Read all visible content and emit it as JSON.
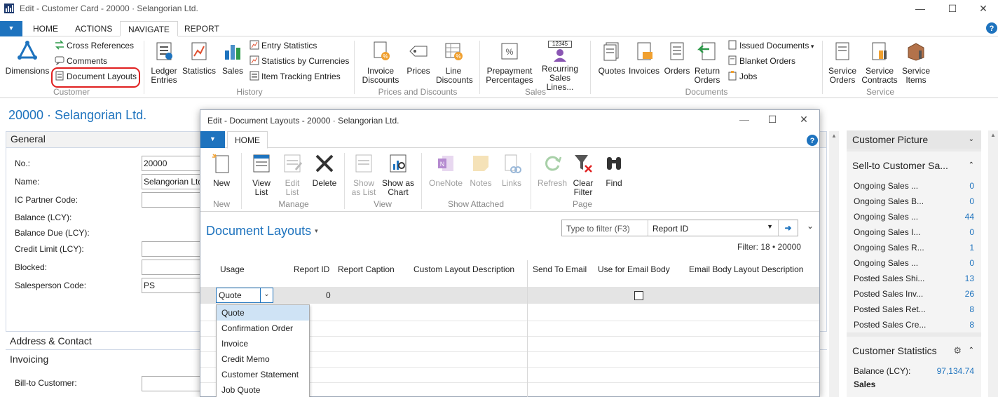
{
  "window": {
    "title": "Edit - Customer Card - 20000 · Selangorian Ltd."
  },
  "ribbon_tabs": [
    "HOME",
    "ACTIONS",
    "NAVIGATE",
    "REPORT"
  ],
  "ribbon": {
    "customer": {
      "dimensions": "Dimensions",
      "cross_references": "Cross References",
      "comments": "Comments",
      "document_layouts": "Document Layouts",
      "label": "Customer"
    },
    "history": {
      "ledger_entries": "Ledger Entries",
      "statistics": "Statistics",
      "sales": "Sales",
      "entry_statistics": "Entry Statistics",
      "statistics_by_currencies": "Statistics by Currencies",
      "item_tracking_entries": "Item Tracking Entries",
      "label": "History"
    },
    "prices": {
      "invoice_discounts": "Invoice Discounts",
      "prices": "Prices",
      "line_discounts": "Line Discounts",
      "label": "Prices and Discounts"
    },
    "sales": {
      "prepayment_percentages": "Prepayment Percentages",
      "recurring_sales_lines": "Recurring Sales Lines...",
      "recurring_badge": "12345",
      "label": "Sales"
    },
    "documents": {
      "quotes": "Quotes",
      "invoices": "Invoices",
      "orders": "Orders",
      "return_orders": "Return Orders",
      "issued_documents": "Issued Documents",
      "blanket_orders": "Blanket Orders",
      "jobs": "Jobs",
      "label": "Documents"
    },
    "service": {
      "service_orders": "Service Orders",
      "service_contracts": "Service Contracts",
      "service_items": "Service Items",
      "label": "Service"
    }
  },
  "page": {
    "title": "20000 · Selangorian Ltd.",
    "general_tab": "General",
    "fields": {
      "no_label": "No.:",
      "no_value": "20000",
      "name_label": "Name:",
      "name_value": "Selangorian Ltd",
      "ic_label": "IC Partner Code:",
      "balance_label": "Balance (LCY):",
      "balance_due_label": "Balance Due (LCY):",
      "credit_limit_label": "Credit Limit (LCY):",
      "blocked_label": "Blocked:",
      "salesperson_label": "Salesperson Code:",
      "salesperson_value": "PS"
    },
    "address_tab": "Address & Contact",
    "invoicing_tab": "Invoicing",
    "bill_to_label": "Bill-to Customer:"
  },
  "factbox": {
    "picture_title": "Customer Picture",
    "sales_title": "Sell-to Customer Sa...",
    "sales_rows": [
      {
        "k": "Ongoing Sales ...",
        "v": "0"
      },
      {
        "k": "Ongoing Sales B...",
        "v": "0"
      },
      {
        "k": "Ongoing Sales ...",
        "v": "44"
      },
      {
        "k": "Ongoing Sales I...",
        "v": "0"
      },
      {
        "k": "Ongoing Sales R...",
        "v": "1"
      },
      {
        "k": "Ongoing Sales ...",
        "v": "0"
      },
      {
        "k": "Posted Sales Shi...",
        "v": "13"
      },
      {
        "k": "Posted Sales Inv...",
        "v": "26"
      },
      {
        "k": "Posted Sales Ret...",
        "v": "8"
      },
      {
        "k": "Posted Sales Cre...",
        "v": "8"
      }
    ],
    "stats_title": "Customer Statistics",
    "balance_label": "Balance (LCY):",
    "balance_value": "97,134.74",
    "sales_label": "Sales"
  },
  "modal": {
    "title": "Edit - Document Layouts - 20000 · Selangorian Ltd.",
    "tab": "HOME",
    "buttons": {
      "new": "New",
      "view_list": "View List",
      "edit_list": "Edit List",
      "delete": "Delete",
      "show_as_list": "Show as List",
      "show_as_chart": "Show as Chart",
      "onenote": "OneNote",
      "notes": "Notes",
      "links": "Links",
      "refresh": "Refresh",
      "clear_filter": "Clear Filter",
      "find": "Find"
    },
    "groups": {
      "new": "New",
      "manage": "Manage",
      "view": "View",
      "show_attached": "Show Attached",
      "page": "Page"
    },
    "page_title": "Document Layouts",
    "filter_placeholder": "Type to filter (F3)",
    "filter_field": "Report ID",
    "filter_status": "Filter: 18 • 20000",
    "columns": [
      "Usage",
      "Report ID",
      "Report Caption",
      "Custom Layout Description",
      "Send To Email",
      "Use for Email Body",
      "Email Body Layout Description"
    ],
    "row": {
      "usage": "Quote",
      "report_id": "0",
      "use_for_email_body": false
    },
    "usage_options": [
      "Quote",
      "Confirmation Order",
      "Invoice",
      "Credit Memo",
      "Customer Statement",
      "Job Quote"
    ],
    "selected_option": "Quote"
  },
  "colors": {
    "accent": "#1e73be",
    "highlight": "#e02020"
  }
}
